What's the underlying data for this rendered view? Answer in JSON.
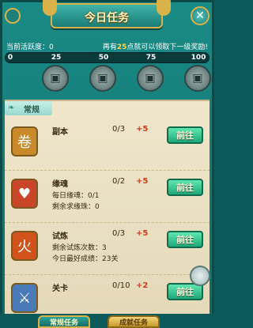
{
  "title": "今日任务",
  "activity": {
    "label": "当前活跃度：0",
    "hint_prefix": "再有",
    "hint_points": "25",
    "hint_suffix": "点就可以领取下一级奖励!",
    "progress_fraction": 0,
    "ticks": [
      "0",
      "25",
      "50",
      "75",
      "100"
    ]
  },
  "chests": [
    "chest-icon",
    "chest-icon",
    "chest-icon",
    "chest-icon"
  ],
  "tab": {
    "label": "常规"
  },
  "tasks": [
    {
      "name": "副本",
      "count": "0/3",
      "reward": "+5",
      "button": "前往",
      "icon": "scroll-icon",
      "icon_color": "#c98a2b",
      "details": []
    },
    {
      "name": "缘魂",
      "count": "0/2",
      "reward": "+5",
      "button": "前往",
      "icon": "heart-icon",
      "icon_color": "#c9462b",
      "details": [
        "每日缘魂：0/1",
        "剩余求缘珠：0"
      ]
    },
    {
      "name": "试炼",
      "count": "0/3",
      "reward": "+5",
      "button": "前往",
      "icon": "flame-icon",
      "icon_color": "#d2521c",
      "details": [
        "剩余试炼次数：3",
        "今日最好成绩：23关"
      ]
    },
    {
      "name": "关卡",
      "count": "0/10",
      "reward": "+2",
      "button": "前往",
      "icon": "sword-icon",
      "icon_color": "#4a7ab8",
      "details": []
    }
  ],
  "bottom_tabs": [
    "常规任务",
    "成就任务"
  ]
}
